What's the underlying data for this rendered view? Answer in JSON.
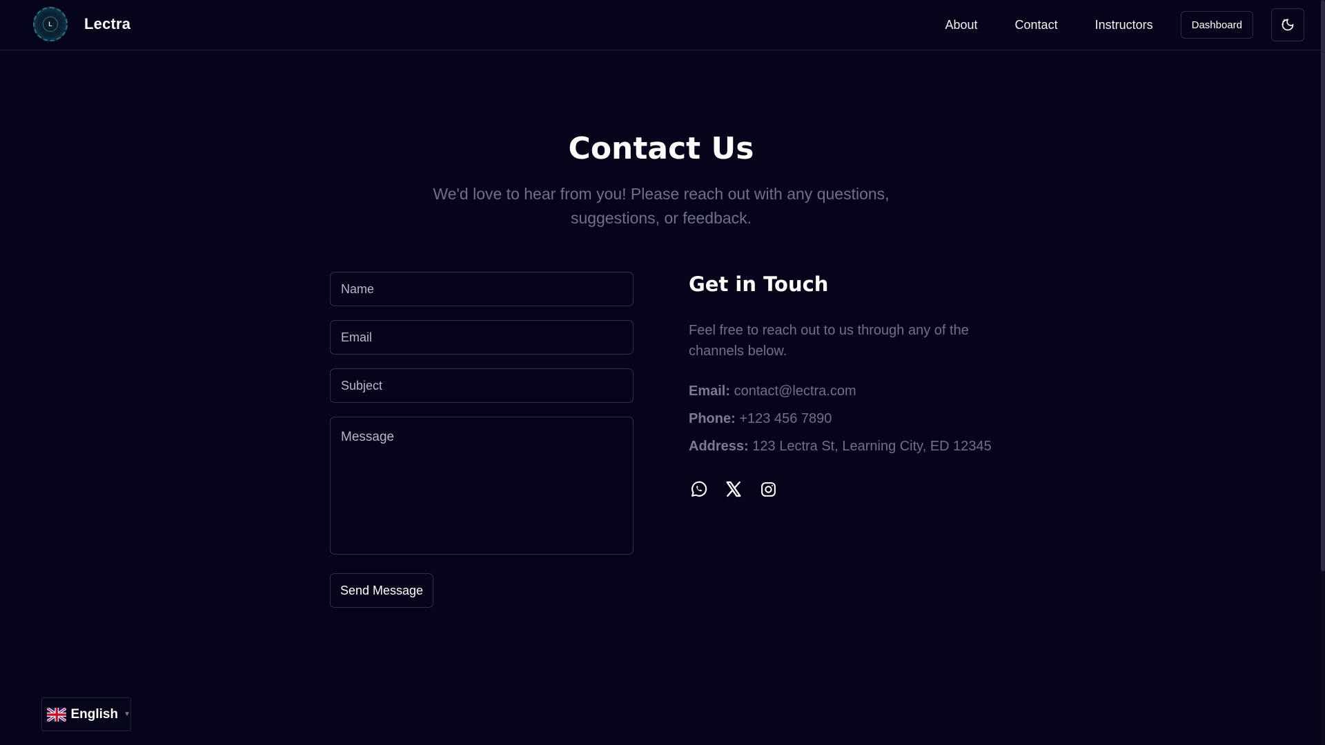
{
  "header": {
    "brand": "Lectra",
    "logo_text": "L",
    "nav": [
      {
        "label": "About"
      },
      {
        "label": "Contact"
      },
      {
        "label": "Instructors"
      }
    ],
    "dashboard_label": "Dashboard",
    "theme_icon": "theme-toggle-icon"
  },
  "page": {
    "title": "Contact Us",
    "subtitle": "We'd love to hear from you! Please reach out with any questions, suggestions, or feedback."
  },
  "form": {
    "name_placeholder": "Name",
    "email_placeholder": "Email",
    "subject_placeholder": "Subject",
    "message_placeholder": "Message",
    "submit_label": "Send Message"
  },
  "contact_info": {
    "heading": "Get in Touch",
    "description": "Feel free to reach out to us through any of the channels below.",
    "email_label": "Email:",
    "email_value": "contact@lectra.com",
    "phone_label": "Phone:",
    "phone_value": "+123 456 7890",
    "address_label": "Address:",
    "address_value": "123 Lectra St, Learning City, ED 12345",
    "socials": [
      "whatsapp-icon",
      "x-icon",
      "instagram-icon"
    ]
  },
  "language": {
    "selected": "English",
    "flag": "uk-flag-icon",
    "caret": "▼"
  },
  "colors": {
    "background": "#05041a",
    "muted_text": "#6f7186",
    "border": "#303046"
  }
}
